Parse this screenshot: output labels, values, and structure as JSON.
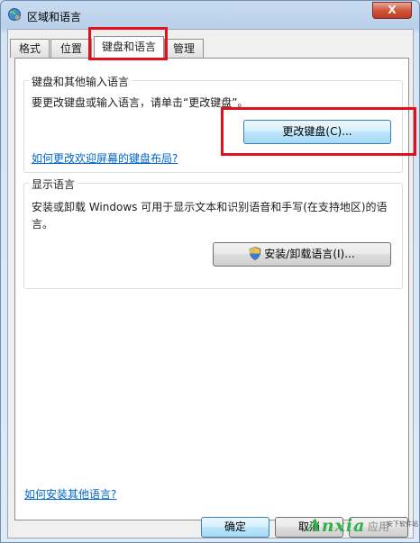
{
  "window": {
    "title": "区域和语言",
    "close_symbol": "X"
  },
  "tabs": [
    {
      "label": "格式",
      "active": false
    },
    {
      "label": "位置",
      "active": false
    },
    {
      "label": "键盘和语言",
      "active": true
    },
    {
      "label": "管理",
      "active": false
    }
  ],
  "keyboard_group": {
    "title": "键盘和其他输入语言",
    "description": "要更改键盘或输入语言，请单击“更改键盘”。",
    "change_keyboard_button": "更改键盘(C)...",
    "welcome_screen_link": "如何更改欢迎屏幕的键盘布局?"
  },
  "display_group": {
    "title": "显示语言",
    "description": "安装或卸载 Windows 可用于显示文本和识别语音和手写(在支持地区)的语言。",
    "install_button": "安装/卸载语言(I)..."
  },
  "other_language_link": "如何安装其他语言?",
  "footer": {
    "ok_label": "确定",
    "cancel_label": "取消",
    "apply_label": "应用"
  },
  "watermark": {
    "main": "Anxia",
    "sub": "安下软件站"
  },
  "colors": {
    "highlight": "#e0101c",
    "link": "#0066cc",
    "close": "#c13a22"
  }
}
